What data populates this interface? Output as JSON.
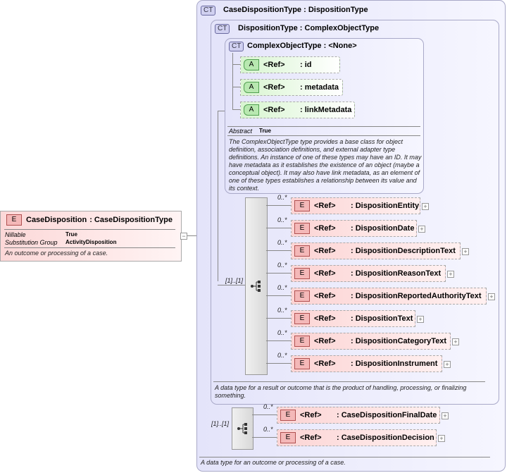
{
  "root": {
    "badge": "E",
    "name": "CaseDisposition",
    "type": ": CaseDispositionType",
    "props": [
      {
        "key": "Nillable",
        "value": "True"
      },
      {
        "key": "Substitution Group",
        "value": "ActivityDisposition"
      }
    ],
    "description": "An outcome or processing of a case.",
    "collapse": "−"
  },
  "case_type": {
    "badge": "CT",
    "title": "CaseDispositionType : DispositionType",
    "description": "A data type for an outcome or processing of a case.",
    "sequence_mult": "[1]..[1]",
    "elements": [
      {
        "mult": "0..*",
        "ref": "<Ref>",
        "name": ": CaseDispositionFinalDate"
      },
      {
        "mult": "0..*",
        "ref": "<Ref>",
        "name": ": CaseDispositionDecision"
      }
    ]
  },
  "disp_type": {
    "badge": "CT",
    "title": "DispositionType : ComplexObjectType",
    "description": "A data type for a result or outcome that is the product of handling, processing, or finalizing something.",
    "sequence_mult": "[1]..[1]",
    "elements": [
      {
        "mult": "0..*",
        "ref": "<Ref>",
        "name": ": DispositionEntity"
      },
      {
        "mult": "0..*",
        "ref": "<Ref>",
        "name": ": DispositionDate"
      },
      {
        "mult": "0..*",
        "ref": "<Ref>",
        "name": ": DispositionDescriptionText"
      },
      {
        "mult": "0..*",
        "ref": "<Ref>",
        "name": ": DispositionReasonText"
      },
      {
        "mult": "0..*",
        "ref": "<Ref>",
        "name": ": DispositionReportedAuthorityText"
      },
      {
        "mult": "0..*",
        "ref": "<Ref>",
        "name": ": DispositionText"
      },
      {
        "mult": "0..*",
        "ref": "<Ref>",
        "name": ": DispositionCategoryText"
      },
      {
        "mult": "0..*",
        "ref": "<Ref>",
        "name": ": DispositionInstrument"
      }
    ]
  },
  "complex_type": {
    "badge": "CT",
    "title": "ComplexObjectType : <None>",
    "abstract_key": "Abstract",
    "abstract_value": "True",
    "description": "The ComplexObjectType type provides a base class for object definition, association definitions, and external adapter type definitions. An instance of one of these types may have an ID. It may have metadata as it establishes the existence of an object (maybe a conceptual object). It may also have link metadata, as an element of one of these types establishes a relationship between its value and its context.",
    "attributes": [
      {
        "badge": "A",
        "ref": "<Ref>",
        "name": ": id"
      },
      {
        "badge": "A",
        "ref": "<Ref>",
        "name": ": metadata"
      },
      {
        "badge": "A",
        "ref": "<Ref>",
        "name": ": linkMetadata"
      }
    ]
  },
  "expand_symbol": "+"
}
